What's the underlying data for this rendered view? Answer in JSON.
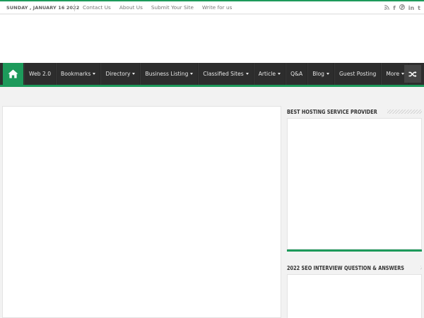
{
  "topbar": {
    "date": "SUNDAY , JANUARY 16 2022",
    "links": [
      "Contact Us",
      "About Us",
      "Submit Your Site",
      "Write for us"
    ],
    "social": [
      {
        "icon": "rss-icon",
        "glyph": "ʐ"
      },
      {
        "icon": "facebook-icon",
        "glyph": "f"
      },
      {
        "icon": "pinterest-icon",
        "glyph": "℗"
      },
      {
        "icon": "linkedin-icon",
        "glyph": "in"
      },
      {
        "icon": "tumblr-icon",
        "glyph": "t"
      }
    ]
  },
  "nav": {
    "home_icon": "home-icon",
    "items": [
      {
        "label": "Web 2.0",
        "has_dropdown": false
      },
      {
        "label": "Bookmarks",
        "has_dropdown": true
      },
      {
        "label": "Directory",
        "has_dropdown": true
      },
      {
        "label": "Business Listing",
        "has_dropdown": true
      },
      {
        "label": "Classified Sites",
        "has_dropdown": true
      },
      {
        "label": "Article",
        "has_dropdown": true
      },
      {
        "label": "Q&A",
        "has_dropdown": false
      },
      {
        "label": "Blog",
        "has_dropdown": true
      },
      {
        "label": "Guest Posting",
        "has_dropdown": false
      },
      {
        "label": "More",
        "has_dropdown": true
      }
    ],
    "random_icon": "shuffle-icon"
  },
  "sidebar": {
    "widget1_title": "Best Hosting Service Provider",
    "widget2_title": "2022 SEO Interview Question & Answers"
  },
  "colors": {
    "accent": "#1d9a5b",
    "nav_bg": "#2d2d2d"
  }
}
